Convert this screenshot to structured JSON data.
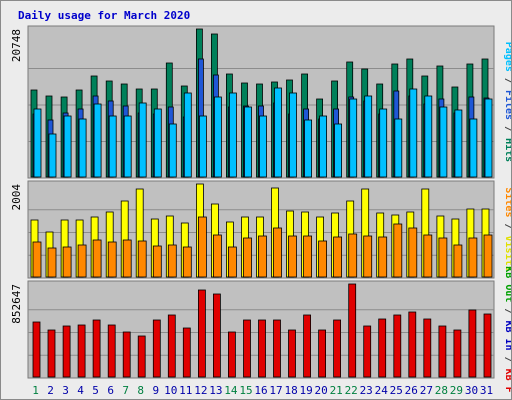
{
  "chart_data": {
    "title": "Daily usage for March 2020",
    "type": "bar",
    "colors": {
      "title": "#0000cc",
      "frame_bg": "#ececec",
      "plot_bg": "#c0c0c0",
      "weekday_label": "#008040",
      "weekend_label": "#0000aa",
      "pages": "#00c0ff",
      "files": "#1f57d6",
      "hits": "#00805a",
      "visits": "#ffff00",
      "sites": "#ff8800",
      "kb_in": "#0000c0",
      "kb_out": "#00a000",
      "kb_f": "#e00000"
    },
    "days": [
      "1",
      "2",
      "3",
      "4",
      "5",
      "6",
      "7",
      "8",
      "9",
      "10",
      "11",
      "12",
      "13",
      "14",
      "15",
      "16",
      "17",
      "18",
      "19",
      "20",
      "21",
      "22",
      "23",
      "24",
      "25",
      "26",
      "27",
      "28",
      "29",
      "30",
      "31"
    ],
    "weekend_days": [
      "1",
      "7",
      "8",
      "14",
      "15",
      "21",
      "22",
      "28",
      "29"
    ],
    "panels": [
      {
        "id": "requests",
        "ymax_label": "20748",
        "ymax": 20748,
        "side_labels": [
          {
            "text": "Hits",
            "color": "#00805a"
          },
          {
            "text": " / ",
            "color": "#444444"
          },
          {
            "text": "Files",
            "color": "#1f57d6"
          },
          {
            "text": " / ",
            "color": "#444444"
          },
          {
            "text": "Pages",
            "color": "#00c0ff"
          }
        ],
        "series": [
          {
            "name": "Hits",
            "color": "#00805a",
            "values": [
              12200,
              11400,
              11200,
              12200,
              14200,
              13400,
              13000,
              12400,
              12400,
              16000,
              12800,
              20748,
              20100,
              14500,
              13200,
              13100,
              13300,
              13600,
              14400,
              11000,
              13400,
              16100,
              15200,
              13000,
              15800,
              16600,
              14200,
              15600,
              12600,
              15900,
              16500
            ]
          },
          {
            "name": "Files",
            "color": "#1f57d6",
            "values": [
              8800,
              8000,
              9000,
              9600,
              11400,
              10600,
              10000,
              9000,
              8800,
              9800,
              8400,
              16600,
              14300,
              9800,
              10000,
              10000,
              10400,
              8800,
              9600,
              8100,
              9600,
              11200,
              10600,
              8800,
              12100,
              11400,
              10200,
              11000,
              9000,
              11200,
              11100
            ]
          },
          {
            "name": "Pages",
            "color": "#00c0ff",
            "values": [
              9600,
              6000,
              8500,
              8100,
              10200,
              8600,
              8600,
              10400,
              9600,
              7400,
              11800,
              8600,
              11200,
              11800,
              9800,
              8500,
              12500,
              11800,
              8000,
              8500,
              7500,
              11000,
              11400,
              9500,
              8200,
              12400,
              11400,
              9800,
              9400,
              8100,
              11000
            ]
          }
        ]
      },
      {
        "id": "visits",
        "ymax_label": "2004",
        "ymax": 2004,
        "side_labels": [
          {
            "text": "Visits",
            "color": "#e0e000"
          },
          {
            "text": " / ",
            "color": "#444444"
          },
          {
            "text": "Sites",
            "color": "#ff8800"
          }
        ],
        "series": [
          {
            "name": "Visits",
            "color": "#ffff00",
            "values": [
              1230,
              960,
              1230,
              1220,
              1300,
              1400,
              1640,
              1900,
              1260,
              1310,
              1160,
              2004,
              1580,
              1180,
              1290,
              1300,
              1920,
              1420,
              1390,
              1300,
              1380,
              1640,
              1900,
              1380,
              1340,
              1410,
              1900,
              1320,
              1250,
              1460,
              1460
            ]
          },
          {
            "name": "Sites",
            "color": "#ff8800",
            "values": [
              760,
              620,
              640,
              700,
              800,
              760,
              800,
              780,
              670,
              690,
              640,
              1300,
              910,
              650,
              840,
              890,
              1050,
              880,
              890,
              770,
              870,
              920,
              890,
              870,
              1140,
              1050,
              900,
              830,
              680,
              840,
              900
            ]
          }
        ]
      },
      {
        "id": "kbytes",
        "ymax_label": "852647",
        "ymax": 852647,
        "side_labels": [
          {
            "text": "KB F",
            "color": "#e00000"
          },
          {
            "text": " / ",
            "color": "#444444"
          },
          {
            "text": "KB In",
            "color": "#0000c0"
          },
          {
            "text": " / ",
            "color": "#444444"
          },
          {
            "text": "KB Out",
            "color": "#00a000"
          }
        ],
        "series": [
          {
            "name": "KB F",
            "color": "#e00000",
            "values": [
              500000,
              430000,
              470000,
              480000,
              520000,
              480000,
              410000,
              380000,
              520000,
              570000,
              450000,
              800000,
              760000,
              410000,
              520000,
              520000,
              520000,
              430000,
              570000,
              430000,
              520000,
              852647,
              470000,
              530000,
              570000,
              600000,
              530000,
              470000,
              430000,
              610000,
              580000
            ]
          }
        ]
      }
    ]
  }
}
